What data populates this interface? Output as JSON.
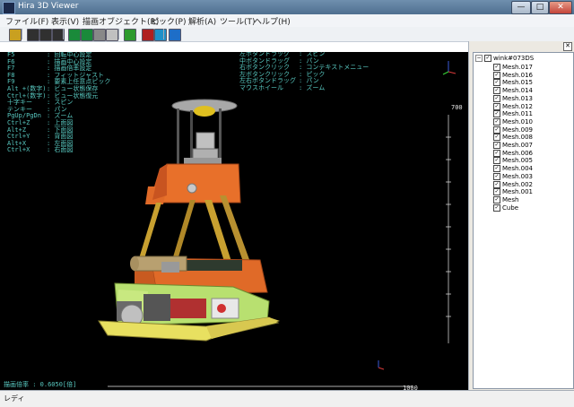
{
  "window": {
    "title": "Hira 3D Viewer",
    "min": "—",
    "max": "□",
    "close": "✕"
  },
  "menu": [
    "ファイル(F)",
    "表示(V)",
    "描画オブジェクト(R)",
    "ピック(P)",
    "解析(A)",
    "ツール(T)",
    "ヘルプ(H)"
  ],
  "toolbar": {
    "icons": [
      "open-folder-icon",
      "axes-xyz-icon",
      "axes-xy-icon",
      "axes-xz-icon",
      "solid-cube-icon",
      "wire-cube-icon",
      "render-icon",
      "shade-icon",
      "pick-node-icon",
      "pick-element-icon",
      "view-front-icon",
      "view-iso-icon"
    ],
    "colors": [
      "#c9a020",
      "#303030",
      "#303030",
      "#303030",
      "#1a8a3a",
      "#1a8a3a",
      "#888888",
      "#c0c0c0",
      "#2d9a2d",
      "#b02020",
      "#1e90c8",
      "#1e6ec8"
    ]
  },
  "help_left": [
    {
      "key": "F5",
      "desc": ": 回転中心設定"
    },
    {
      "key": "F6",
      "desc": ": 描画中心設定"
    },
    {
      "key": "F7",
      "desc": ": 描画倍率設定"
    },
    {
      "key": "F8",
      "desc": ": フィットジャスト"
    },
    {
      "key": "F9",
      "desc": ": 要素上任意点ピック"
    },
    {
      "key": "Alt +(数字)",
      "desc": ": ビュー状態保存"
    },
    {
      "key": "Ctrl+(数字)",
      "desc": ": ビュー状態復元"
    },
    {
      "key": "十字キー",
      "desc": ": スピン"
    },
    {
      "key": "テンキー",
      "desc": ": パン"
    },
    {
      "key": "PgUp/PgDn",
      "desc": ": ズーム"
    },
    {
      "key": "Ctrl+Z",
      "desc": ": 上面図"
    },
    {
      "key": "Alt+Z",
      "desc": ": 下面図"
    },
    {
      "key": "Ctrl+Y",
      "desc": ": 背面図"
    },
    {
      "key": "Alt+X",
      "desc": ": 左面図"
    },
    {
      "key": "Ctrl+X",
      "desc": ": 右面図"
    }
  ],
  "help_right": [
    {
      "key": "左ボタンドラッグ",
      "desc": ": スピン"
    },
    {
      "key": "中ボタンドラッグ",
      "desc": ": パン"
    },
    {
      "key": "右ボタンクリック",
      "desc": ": コンテキストメニュー"
    },
    {
      "key": "左ボタンクリック",
      "desc": ": ピック"
    },
    {
      "key": "左右ボタンドラッグ",
      "desc": ": パン"
    },
    {
      "key": "マウスホイール",
      "desc": ": ズーム"
    }
  ],
  "scale": {
    "y_label": "700",
    "x_label": "1000"
  },
  "magnification": "描画倍率 :   0.6050[倍]",
  "tree": {
    "root": "wink#073DS",
    "items": [
      "Mesh.017",
      "Mesh.016",
      "Mesh.015",
      "Mesh.014",
      "Mesh.013",
      "Mesh.012",
      "Mesh.011",
      "Mesh.010",
      "Mesh.009",
      "Mesh.008",
      "Mesh.007",
      "Mesh.006",
      "Mesh.005",
      "Mesh.004",
      "Mesh.003",
      "Mesh.002",
      "Mesh.001",
      "Mesh",
      "Cube"
    ],
    "checked": true
  },
  "status": {
    "text": "レディ"
  }
}
